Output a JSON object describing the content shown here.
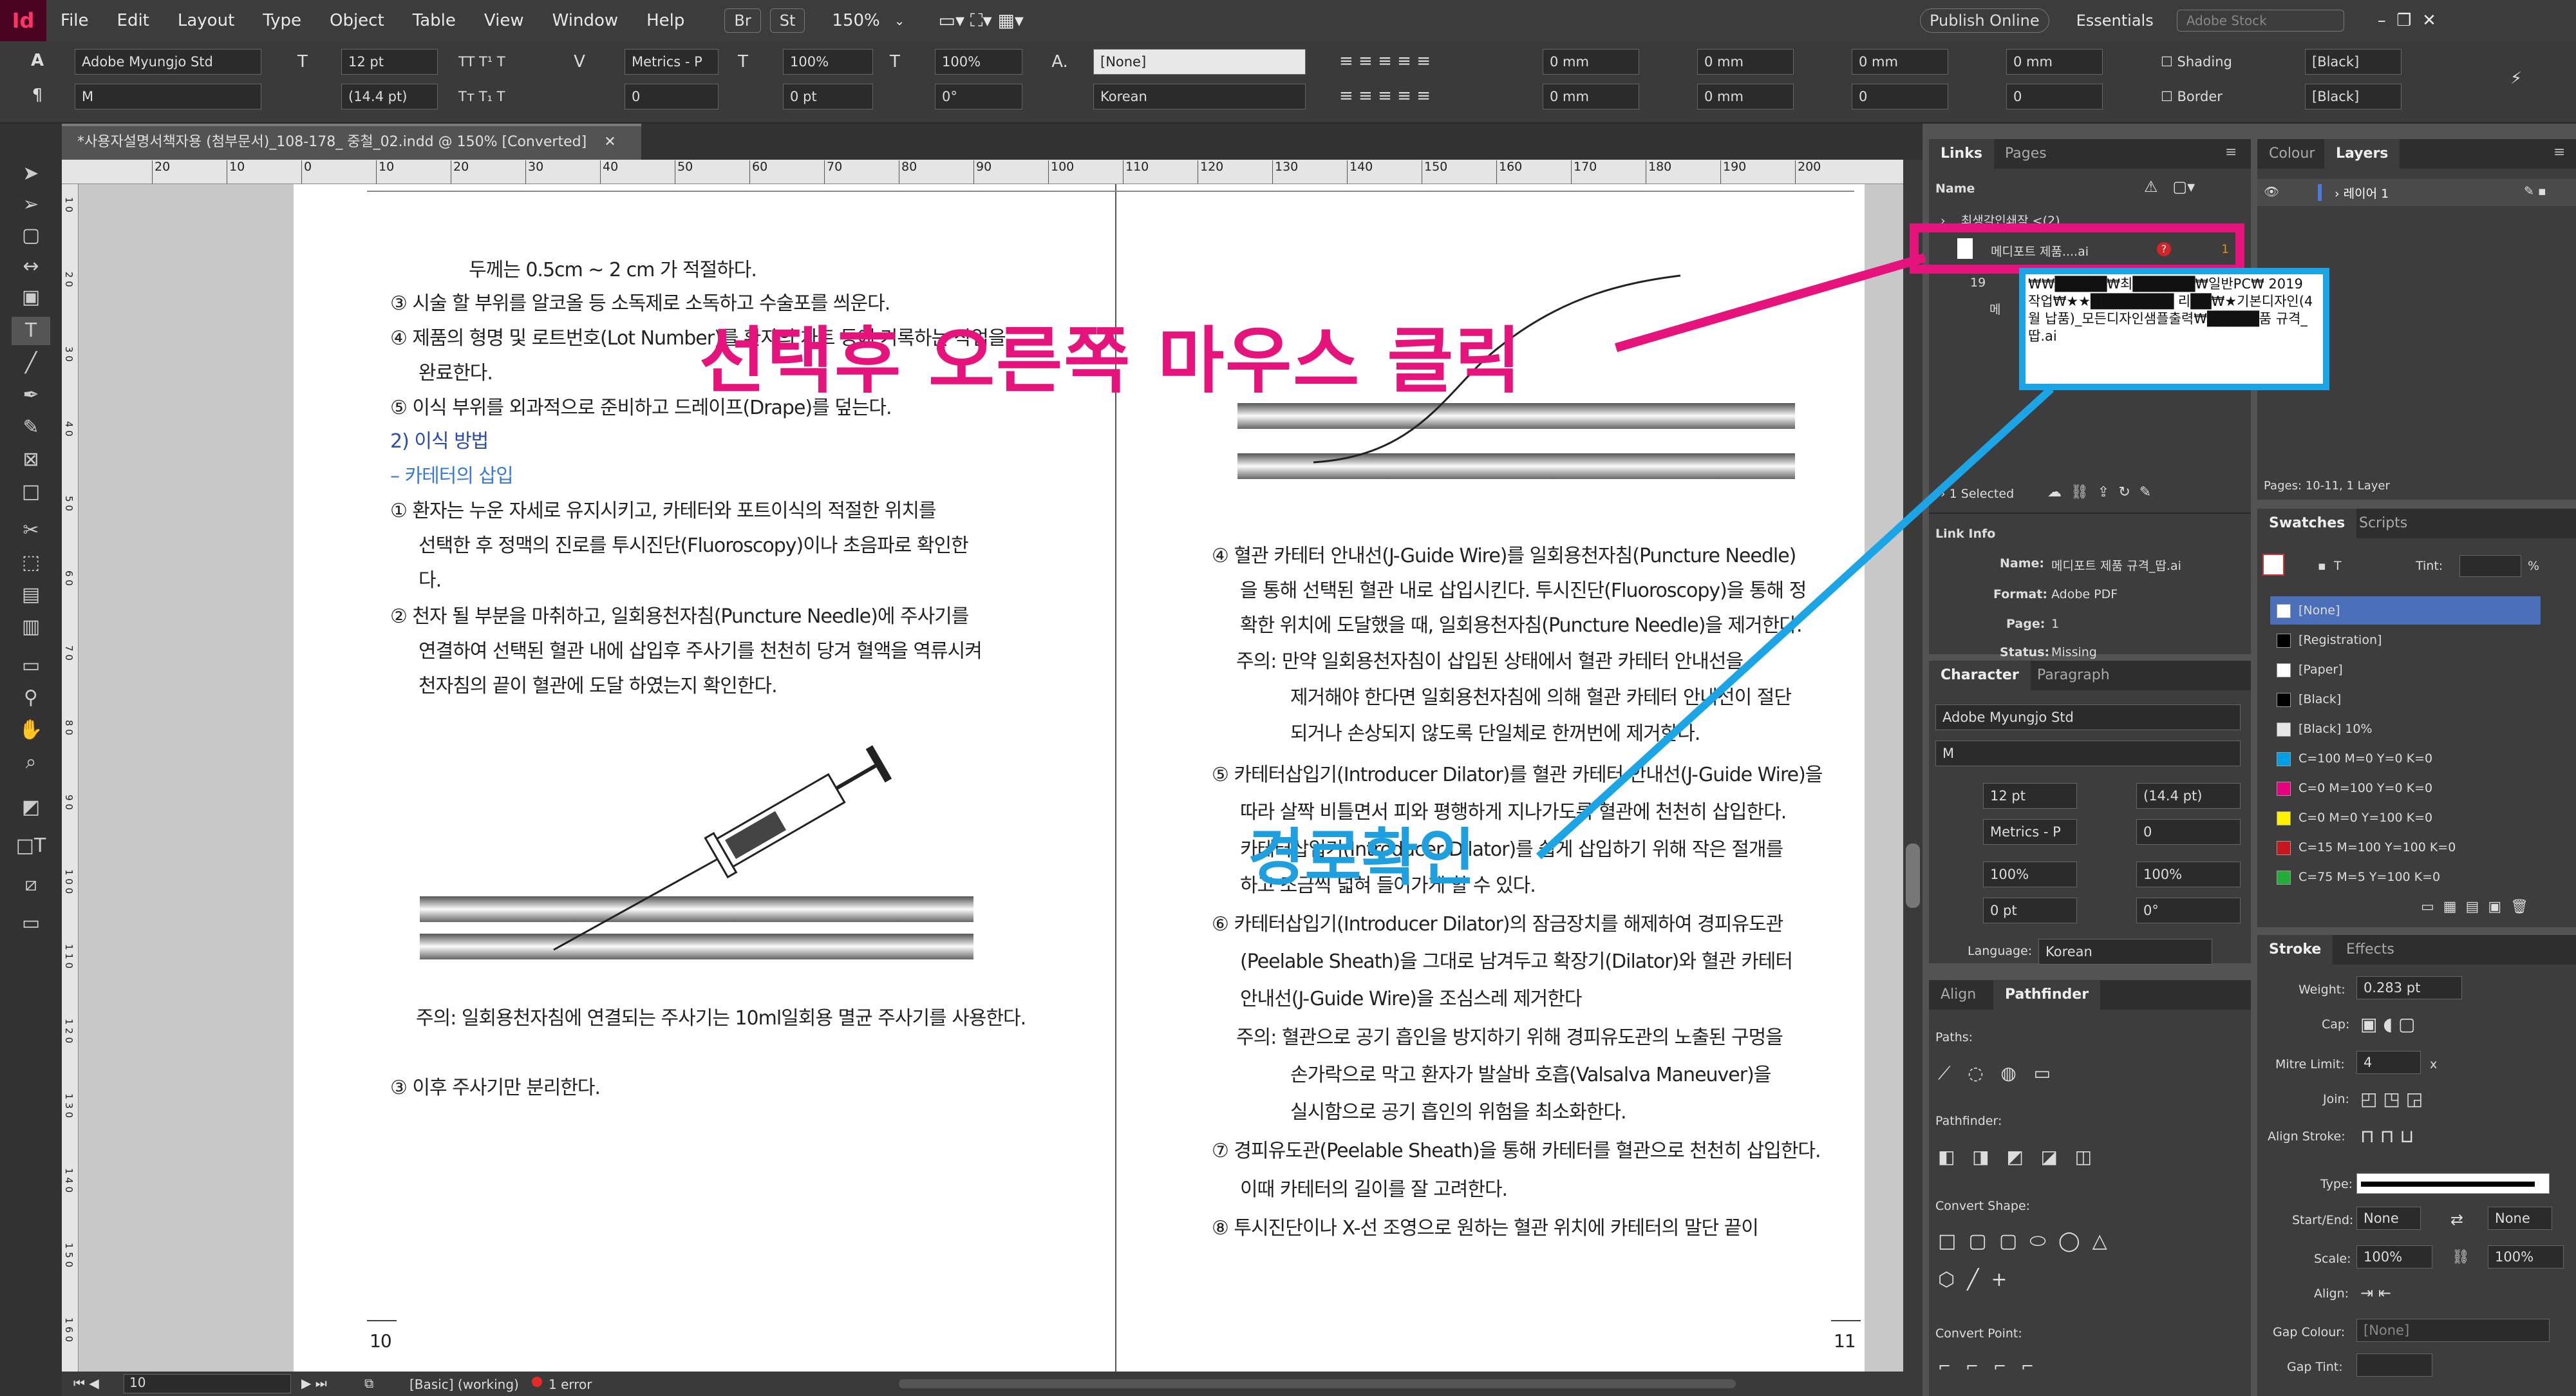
{
  "app": {
    "logo": "Id",
    "menu": [
      "File",
      "Edit",
      "Layout",
      "Type",
      "Object",
      "Table",
      "View",
      "Window",
      "Help"
    ],
    "br": "Br",
    "st": "St",
    "zoom": "150%",
    "publish": "Publish Online",
    "workspace": "Essentials",
    "stock_placeholder": "Adobe Stock"
  },
  "control": {
    "font": "Adobe Myungjo Std",
    "style": "M",
    "size": "12 pt",
    "leading": "(14.4 pt)",
    "kerning": "Metrics - P",
    "tracking": "0",
    "vscale": "100%",
    "hscale": "100%",
    "baseline": "0 pt",
    "skew": "0°",
    "charstyle": "[None]",
    "language": "Korean",
    "indent_left": "0 mm",
    "indent_right": "0 mm",
    "space_before": "0 mm",
    "space_after": "0 mm",
    "first_line": "0 mm",
    "last_line": "0 mm",
    "drop1": "0",
    "drop2": "0",
    "shading": "Shading",
    "border": "Border",
    "color1": "[Black]",
    "color2": "[Black]"
  },
  "document": {
    "tab_title": "*사용자설명서책자용 (첨부문서)_108-178_ 중철_02.indd @ 150% [Converted]",
    "ruler_labels": [
      "20",
      "10",
      "0",
      "10",
      "20",
      "30",
      "40",
      "50",
      "60",
      "70",
      "80",
      "90",
      "100",
      "110",
      "120",
      "130",
      "140",
      "150",
      "160",
      "170",
      "180",
      "190",
      "200"
    ],
    "vruler_labels": [
      "1 0",
      "2 0",
      "3 0",
      "4 0",
      "5 0",
      "6 0",
      "7 0",
      "8 0",
      "9 0",
      "1 0 0",
      "1 1 0",
      "1 2 0",
      "1 3 0",
      "1 4 0",
      "1 5 0",
      "1 6 0",
      "1 7 0"
    ],
    "left_page": {
      "l1": "두께는 0.5cm ~ 2 cm 가 적절하다.",
      "l2": "③ 시술 할 부위를 알코올 등 소독제로 소독하고 수술포를 씌운다.",
      "l3": "④ 제품의 형명 및 로트번호(Lot Number)를 환자의 차트 등에 기록하는 작업을",
      "l4": "완료한다.",
      "l5": "⑤ 이식 부위를 외과적으로 준비하고 드레이프(Drape)를 덮는다.",
      "h1": "2) 이식 방법",
      "h2": "– 카테터의 삽입",
      "l6": "① 환자는 누운 자세로 유지시키고, 카테터와 포트이식의 적절한 위치를",
      "l7": "선택한 후 정맥의 진로를 투시진단(Fluoroscopy)이나 초음파로 확인한",
      "l8": "다.",
      "l9": "② 천자 될 부분을 마취하고, 일회용천자침(Puncture Needle)에 주사기를",
      "l10": "연결하여 선택된 혈관 내에 삽입후 주사기를 천천히 당겨 혈액을 역류시켜",
      "l11": "천자침의 끝이 혈관에 도달 하였는지 확인한다.",
      "note": "주의: 일회용천자침에 연결되는 주사기는 10ml일회용 멸균 주사기를 사용한다.",
      "l12": "③ 이후 주사기만 분리한다.",
      "page_no": "10"
    },
    "right_page": {
      "r1": "④ 혈관 카테터 안내선(J-Guide Wire)를 일회용천자침(Puncture Needle)",
      "r2": "을 통해 선택된 혈관 내로 삽입시킨다. 투시진단(Fluoroscopy)을 통해 정",
      "r3": "확한 위치에 도달했을 때, 일회용천자침(Puncture Needle)을 제거한다.",
      "r4": "주의: 만약 일회용천자침이 삽입된 상태에서 혈관 카테터 안내선을",
      "r5": "제거해야 한다면 일회용천자침에 의해 혈관 카테터 안내선이 절단",
      "r6": "되거나 손상되지 않도록 단일체로 한꺼번에 제거한다.",
      "r7": "⑤ 카테터삽입기(Introducer Dilator)를 혈관 카테터 안내선(J-Guide Wire)을",
      "r8": "따라 살짝 비틀면서 피와 평행하게 지나가도록 혈관에 천천히 삽입한다.",
      "r9": "카테터삽입기(Introducer Dilator)를 쉽게 삽입하기 위해 작은 절개를",
      "r10": "하고 조금씩 넓혀 들어가게 할 수 있다.",
      "r11": "⑥ 카테터삽입기(Introducer Dilator)의 잠금장치를 해제하여 경피유도관",
      "r12": "(Peelable Sheath)을 그대로 남겨두고 확장기(Dilator)와 혈관 카테터",
      "r13": "안내선(J-Guide Wire)을 조심스레 제거한다",
      "r14": "주의: 혈관으로 공기 흡인을 방지하기 위해 경피유도관의 노출된 구멍을",
      "r15": "손가락으로 막고 환자가 발살바 호흡(Valsalva Maneuver)을",
      "r16": "실시함으로 공기 흡인의 위험을 최소화한다.",
      "r17": "⑦ 경피유도관(Peelable Sheath)을 통해 카테터를 혈관으로 천천히 삽입한다.",
      "r18": "이때 카테터의 길이를 잘 고려한다.",
      "r19": "⑧ 투시진단이나 X-선 조영으로 원하는 혈관 위치에 카테터의 말단 끝이",
      "page_no": "11"
    }
  },
  "annotations": {
    "right_click": "선택후 오른쪽 마우스 클릭",
    "check_path": "경로확인",
    "path_tooltip": "₩₩█████₩최██████₩일반PC₩ 2019 작업₩★★████████ 리██₩★기본디자인(4월 납품)_모든디자인샘플출력₩█████품 규격_땁.ai"
  },
  "links_panel": {
    "tabs": [
      "Links",
      "Pages"
    ],
    "col_name": "Name",
    "items": [
      "최생각인쇄작 <(2)",
      "메디포트 제품....ai",
      "19",
      "메"
    ],
    "selected_warning": "?",
    "selected_page": "1",
    "status": "1 Selected",
    "link_info_title": "Link Info",
    "info": [
      {
        "k": "Name:",
        "v": "메디포트 제품 규격_땁.ai"
      },
      {
        "k": "Format:",
        "v": "Adobe PDF"
      },
      {
        "k": "Page:",
        "v": "1"
      },
      {
        "k": "Status:",
        "v": "Missing"
      }
    ]
  },
  "layers_panel": {
    "tabs": [
      "Colour",
      "Layers"
    ],
    "layer": "레이어 1",
    "footer": "Pages: 10-11, 1 Layer"
  },
  "swatches_panel": {
    "tabs": [
      "Swatches",
      "Scripts"
    ],
    "tint_label": "Tint:",
    "tint_unit": "%",
    "items": [
      {
        "name": "[None]",
        "color": "#ffffff"
      },
      {
        "name": "[Registration]",
        "color": "#000000"
      },
      {
        "name": "[Paper]",
        "color": "#ffffff"
      },
      {
        "name": "[Black]",
        "color": "#000000"
      },
      {
        "name": "[Black] 10%",
        "color": "#e6e6e6"
      },
      {
        "name": "C=100 M=0 Y=0 K=0",
        "color": "#00a0e9"
      },
      {
        "name": "C=0 M=100 Y=0 K=0",
        "color": "#e4007f"
      },
      {
        "name": "C=0 M=0 Y=100 K=0",
        "color": "#fff100"
      },
      {
        "name": "C=15 M=100 Y=100 K=0",
        "color": "#c8161d"
      },
      {
        "name": "C=75 M=5 Y=100 K=0",
        "color": "#22ac38"
      }
    ]
  },
  "character_panel": {
    "tabs": [
      "Character",
      "Paragraph"
    ],
    "font": "Adobe Myungjo Std",
    "style": "M",
    "size": "12 pt",
    "leading": "(14.4 pt)",
    "kerning": "Metrics - P",
    "tracking": "0",
    "vscale": "100%",
    "hscale": "100%",
    "baseline": "0 pt",
    "skew": "0°",
    "language_label": "Language:",
    "language": "Korean"
  },
  "pathfinder_panel": {
    "tabs": [
      "Align",
      "Pathfinder"
    ],
    "paths": "Paths:",
    "pathfinder": "Pathfinder:",
    "convert_shape": "Convert Shape:",
    "convert_point": "Convert Point:"
  },
  "stroke_panel": {
    "tabs": [
      "Stroke",
      "Effects"
    ],
    "weight_label": "Weight:",
    "weight": "0.283 pt",
    "cap": "Cap:",
    "mitre_label": "Mitre Limit:",
    "mitre": "4",
    "mitre_x": "x",
    "join": "Join:",
    "align_stroke": "Align Stroke:",
    "type": "Type:",
    "startend": "Start/End:",
    "start": "None",
    "end": "None",
    "scale": "Scale:",
    "scale1": "100%",
    "scale2": "100%",
    "align": "Align:",
    "gap_colour": "Gap Colour:",
    "gap_colour_val": "[None]",
    "gap_tint": "Gap Tint:"
  },
  "status": {
    "page": "10",
    "style": "[Basic] (working)",
    "errors": "1 error"
  },
  "colors": {
    "accent_magenta": "#e6137c",
    "accent_cyan": "#1ba4e6",
    "heading_blue": "#2b4bb0"
  }
}
